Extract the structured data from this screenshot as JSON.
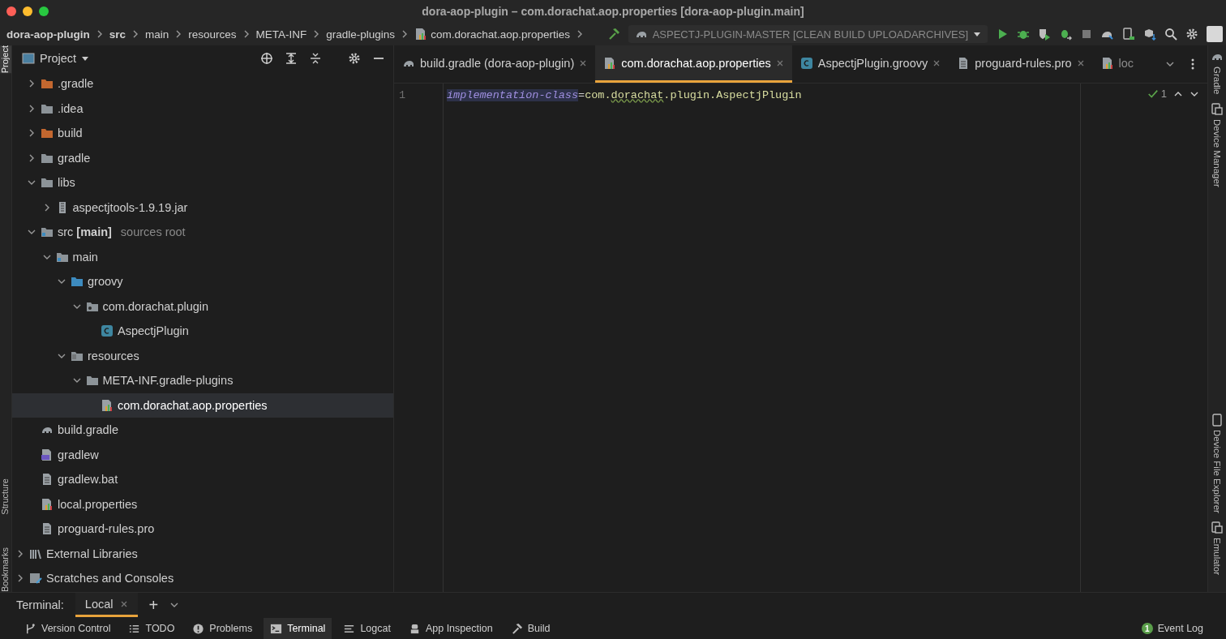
{
  "window": {
    "title": "dora-aop-plugin – com.dorachat.aop.properties [dora-aop-plugin.main]"
  },
  "breadcrumbs": [
    {
      "label": "dora-aop-plugin",
      "bold": true,
      "kind": "segment"
    },
    {
      "label": "src",
      "bold": true,
      "kind": "segment"
    },
    {
      "label": "main",
      "bold": false,
      "kind": "segment"
    },
    {
      "label": "resources",
      "bold": false,
      "kind": "segment"
    },
    {
      "label": "META-INF",
      "bold": false,
      "kind": "segment"
    },
    {
      "label": "gradle-plugins",
      "bold": false,
      "kind": "segment"
    },
    {
      "label": "com.dorachat.aop.properties",
      "bold": false,
      "kind": "properties"
    }
  ],
  "run_config": {
    "label": "ASPECTJ-PLUGIN-MASTER [CLEAN BUILD UPLOADARCHIVES]"
  },
  "left_strip": [
    {
      "label": "Project",
      "selected": true
    },
    {
      "label": "Structure",
      "selected": false
    },
    {
      "label": "Bookmarks",
      "selected": false
    }
  ],
  "project_panel": {
    "title": "Project"
  },
  "tree": [
    {
      "label": ".gradle",
      "kind": "folder-excluded",
      "expanded": false,
      "selected": false
    },
    {
      "label": ".idea",
      "kind": "folder",
      "expanded": false,
      "selected": false
    },
    {
      "label": "build",
      "kind": "folder-excluded",
      "expanded": false,
      "selected": false
    },
    {
      "label": "gradle",
      "kind": "folder",
      "expanded": false,
      "selected": false
    },
    {
      "label": "libs",
      "kind": "folder",
      "expanded": true,
      "selected": false,
      "children": [
        {
          "label": "aspectjtools-1.9.19.jar",
          "kind": "jar",
          "expanded": false,
          "selected": false
        }
      ]
    },
    {
      "label": "src **[main]**",
      "hint": "sources root",
      "kind": "module-folder",
      "expanded": true,
      "selected": false,
      "children": [
        {
          "label": "main",
          "kind": "module-folder",
          "expanded": true,
          "selected": false,
          "children": [
            {
              "label": "groovy",
              "kind": "source-folder",
              "expanded": true,
              "selected": false,
              "children": [
                {
                  "label": "com.dorachat.plugin",
                  "kind": "package",
                  "expanded": true,
                  "selected": false,
                  "children": [
                    {
                      "label": "AspectjPlugin",
                      "kind": "class",
                      "selected": false
                    }
                  ]
                }
              ]
            },
            {
              "label": "resources",
              "kind": "resources-folder",
              "expanded": true,
              "selected": false,
              "children": [
                {
                  "label": "META-INF.gradle-plugins",
                  "kind": "folder",
                  "expanded": true,
                  "selected": false,
                  "children": [
                    {
                      "label": "com.dorachat.aop.properties",
                      "kind": "properties",
                      "selected": true
                    }
                  ]
                }
              ]
            }
          ]
        }
      ]
    },
    {
      "label": "build.gradle",
      "kind": "gradle",
      "selected": false
    },
    {
      "label": "gradlew",
      "kind": "script",
      "selected": false
    },
    {
      "label": "gradlew.bat",
      "kind": "file",
      "selected": false
    },
    {
      "label": "local.properties",
      "kind": "properties",
      "selected": false
    },
    {
      "label": "proguard-rules.pro",
      "kind": "file",
      "selected": false
    },
    {
      "label": "External Libraries",
      "kind": "libraries",
      "expanded": false,
      "selected": false
    },
    {
      "label": "Scratches and Consoles",
      "kind": "scratches",
      "expanded": false,
      "selected": false
    }
  ],
  "tabs": [
    {
      "label": "build.gradle (dora-aop-plugin)",
      "kind": "gradle",
      "selected": false,
      "closable": true
    },
    {
      "label": "com.dorachat.aop.properties",
      "kind": "properties",
      "selected": true,
      "closable": true
    },
    {
      "label": "AspectjPlugin.groovy",
      "kind": "class",
      "selected": false,
      "closable": true
    },
    {
      "label": "proguard-rules.pro",
      "kind": "file",
      "selected": false,
      "closable": true
    },
    {
      "label": "loc",
      "kind": "properties",
      "selected": false,
      "closable": false
    }
  ],
  "editor": {
    "lines": [
      {
        "number": "1",
        "tokens": [
          {
            "kind": "key",
            "text": "implementation-class"
          },
          {
            "kind": "sep",
            "text": "="
          },
          {
            "kind": "value",
            "text": "com."
          },
          {
            "kind": "typo",
            "text": "dorachat"
          },
          {
            "kind": "value",
            "text": ".plugin.AspectjPlugin"
          }
        ]
      }
    ],
    "inspection_count": "1"
  },
  "right_strip": [
    {
      "label": "Gradle",
      "kind": "gradle"
    },
    {
      "label": "Device Manager",
      "kind": "device"
    },
    {
      "label": "Device File Explorer",
      "kind": "phone"
    },
    {
      "label": "Emulator",
      "kind": "device"
    }
  ],
  "terminal": {
    "label": "Terminal:",
    "tabs": [
      {
        "label": "Local",
        "selected": true
      }
    ],
    "add": "+"
  },
  "status_bar": {
    "items": [
      {
        "label": "Version Control",
        "kind": "branch",
        "selected": false
      },
      {
        "label": "TODO",
        "kind": "list",
        "selected": false
      },
      {
        "label": "Problems",
        "kind": "alert",
        "selected": false
      },
      {
        "label": "Terminal",
        "kind": "terminal",
        "selected": true
      },
      {
        "label": "Logcat",
        "kind": "lines",
        "selected": false
      },
      {
        "label": "App Inspection",
        "kind": "robot",
        "selected": false
      },
      {
        "label": "Build",
        "kind": "hammer",
        "selected": false
      }
    ],
    "event_log": {
      "label": "Event Log",
      "count": "1"
    }
  }
}
